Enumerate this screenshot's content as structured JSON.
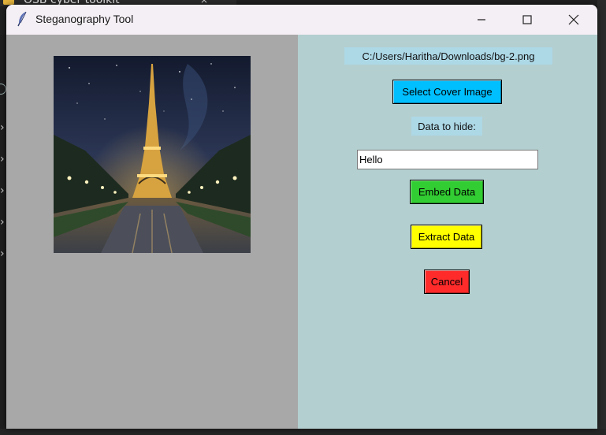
{
  "background_window": {
    "tab_title": "OSB cyber toolkit",
    "tab_close": "×",
    "tab_new": "+"
  },
  "window": {
    "title": "Steganography Tool",
    "icon": "feather-icon",
    "controls": [
      "minimize-icon",
      "maximize-icon",
      "close-icon"
    ]
  },
  "left_pane": {
    "image_description": "eiffel-tower-night-preview",
    "background": "#a8a8a8"
  },
  "right_pane": {
    "background": "#b4cfd0",
    "file_path": "C:/Users/Haritha/Downloads/bg-2.png",
    "select_button": "Select Cover Image",
    "data_label": "Data to hide:",
    "data_input_value": "Hello",
    "embed_button": "Embed Data",
    "extract_button": "Extract Data",
    "cancel_button": "Cancel"
  },
  "colors": {
    "select": "#00bfff",
    "embed": "#32cd32",
    "extract": "#ffff00",
    "cancel": "#ff2b2b",
    "label_bg": "#add8e6"
  }
}
